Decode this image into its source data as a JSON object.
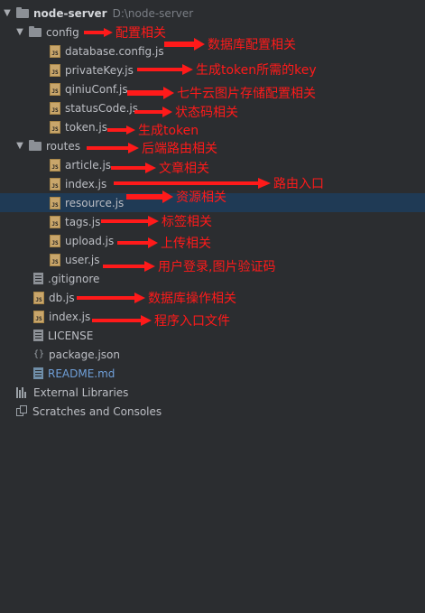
{
  "project": {
    "name": "node-server",
    "path": "D:\\node-server"
  },
  "tree": {
    "config": "config",
    "database_config": "database.config.js",
    "private_key": "privateKey.js",
    "qiniu_conf": "qiniuConf.js",
    "status_code": "statusCode.js",
    "token": "token.js",
    "routes": "routes",
    "article": "article.js",
    "index_route": "index.js",
    "resource": "resource.js",
    "tags": "tags.js",
    "upload": "upload.js",
    "user": "user.js",
    "gitignore": ".gitignore",
    "db": "db.js",
    "index_root": "index.js",
    "license": "LICENSE",
    "package_json": "package.json",
    "readme": "README.md",
    "external_libraries": "External Libraries",
    "scratches": "Scratches and Consoles"
  },
  "annotations": {
    "config": "配置相关",
    "database_config": "数据库配置相关",
    "private_key": "生成token所需的key",
    "qiniu_conf": "七牛云图片存储配置相关",
    "status_code": "状态码相关",
    "token": "生成token",
    "routes": "后端路由相关",
    "article": "文章相关",
    "index_route": "路由入口",
    "resource": "资源相关",
    "tags": "标签相关",
    "upload": "上传相关",
    "user": "用户登录,图片验证码",
    "db": "数据库操作相关",
    "index_root": "程序入口文件"
  },
  "colors": {
    "annotation": "#ff1a1a",
    "selected_row": "#1f3a55",
    "background": "#2b2d30"
  }
}
